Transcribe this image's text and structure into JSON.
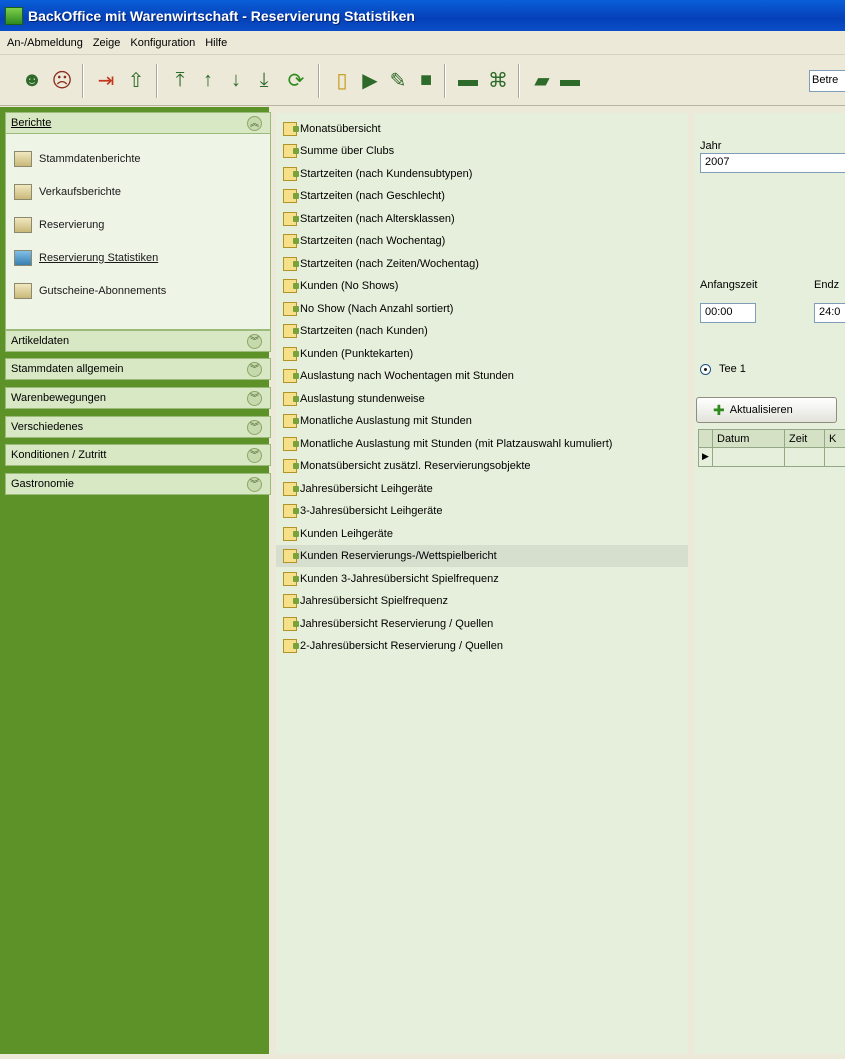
{
  "window": {
    "title": "BackOffice mit Warenwirtschaft - Reservierung Statistiken"
  },
  "menu": [
    "An-/Abmeldung",
    "Zeige",
    "Konfiguration",
    "Hilfe"
  ],
  "toolbar": {
    "icons": [
      "user-icon",
      "user-remove-icon",
      "exit-icon",
      "upload-icon",
      "first-record-icon",
      "previous-record-icon",
      "next-record-icon",
      "last-record-icon",
      "refresh-icon",
      "document-icon",
      "forward-icon",
      "edit-icon",
      "delete-icon",
      "book-icon",
      "binoculars-icon",
      "printer-icon",
      "card-icon"
    ],
    "combo_value": "Betre"
  },
  "sidebar": {
    "active_section": "Berichte",
    "items": [
      {
        "label": "Stammdatenberichte",
        "icon": "report-folder-icon"
      },
      {
        "label": "Verkaufsberichte",
        "icon": "sales-report-icon"
      },
      {
        "label": "Reservierung",
        "icon": "reservation-icon"
      },
      {
        "label": "Reservierung Statistiken",
        "icon": "golf-flag-icon"
      },
      {
        "label": "Gutscheine-Abonnements",
        "icon": "voucher-icon"
      }
    ],
    "sections": [
      "Artikeldaten",
      "Stammdaten allgemein",
      "Warenbewegungen",
      "Verschiedenes",
      "Konditionen / Zutritt",
      "Gastronomie"
    ]
  },
  "reports": [
    "Monatsübersicht",
    "Summe über Clubs",
    "Startzeiten (nach Kundensubtypen)",
    "Startzeiten (nach Geschlecht)",
    "Startzeiten (nach Altersklassen)",
    "Startzeiten (nach Wochentag)",
    "Startzeiten (nach Zeiten/Wochentag)",
    "Kunden (No Shows)",
    "No Show (Nach Anzahl sortiert)",
    "Startzeiten (nach Kunden)",
    "Kunden (Punktekarten)",
    "Auslastung nach Wochentagen mit Stunden",
    "Auslastung stundenweise",
    "Monatliche Auslastung mit Stunden",
    "Monatliche Auslastung mit Stunden (mit Platzauswahl kumuliert)",
    "Monatsübersicht zusätzl. Reservierungsobjekte",
    "Jahresübersicht Leihgeräte",
    "3-Jahresübersicht Leihgeräte",
    "Kunden Leihgeräte",
    "Kunden Reservierungs-/Wettspielbericht",
    "Kunden 3-Jahresübersicht Spielfrequenz",
    "Jahresübersicht Spielfrequenz",
    "Jahresübersicht Reservierung / Quellen",
    "2-Jahresübersicht Reservierung / Quellen"
  ],
  "selected_report": "Kunden Reservierungs-/Wettspielbericht",
  "params": {
    "year_label": "Jahr",
    "year_value": "2007",
    "start_label": "Anfangszeit",
    "start_value": "00:00",
    "end_label": "Endz",
    "end_value": "24:0",
    "tee_label": "Tee 1",
    "refresh_label": "Aktualisieren",
    "grid_columns": [
      "Datum",
      "Zeit",
      "K"
    ]
  }
}
